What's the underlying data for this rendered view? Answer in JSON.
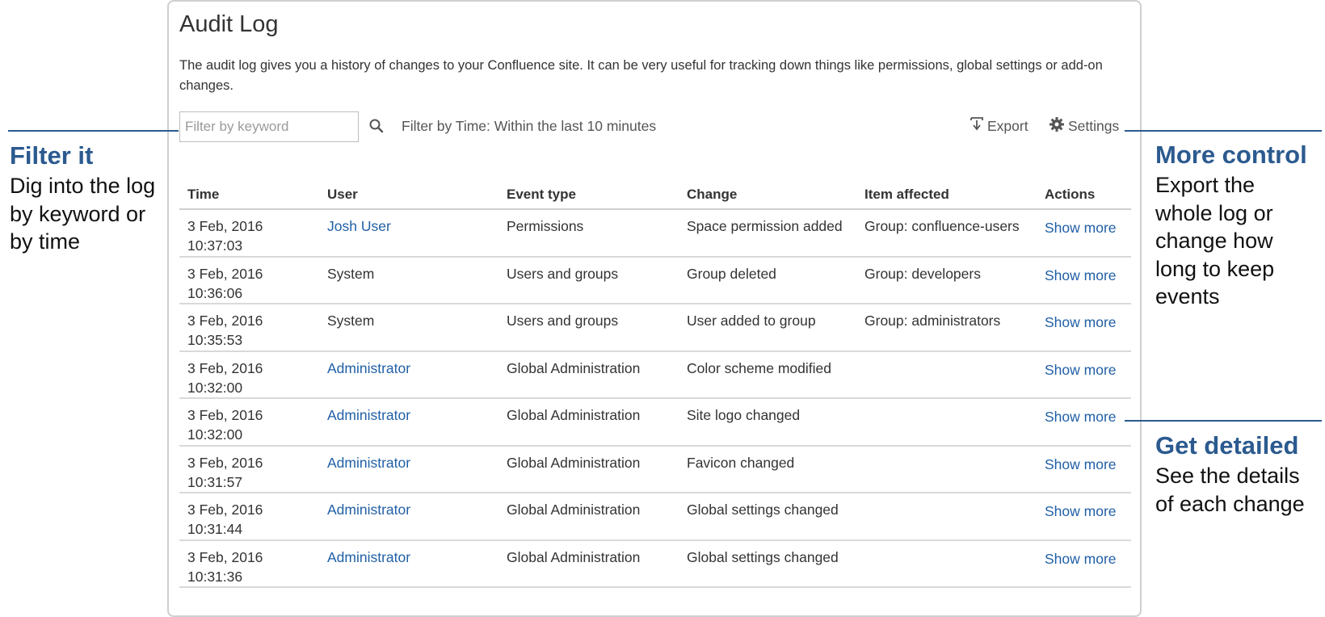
{
  "header": {
    "title": "Audit Log",
    "description": "The audit log gives you a history of changes to your Confluence site. It can be very useful for tracking down things like permissions, global settings or add-on changes."
  },
  "toolbar": {
    "filter_placeholder": "Filter by keyword",
    "filter_value": "",
    "time_filter": "Filter by Time: Within the last 10 minutes",
    "export_label": "Export",
    "settings_label": "Settings",
    "icons": [
      "search-icon",
      "export-icon",
      "gear-icon"
    ]
  },
  "table": {
    "columns": [
      "Time",
      "User",
      "Event type",
      "Change",
      "Item affected",
      "Actions"
    ],
    "rows": [
      {
        "date": "3 Feb, 2016",
        "time": "10:37:03",
        "user": "Josh User",
        "user_link": true,
        "event": "Permissions",
        "change": "Space permission added",
        "item": "Group: confluence-users",
        "action": "Show more"
      },
      {
        "date": "3 Feb, 2016",
        "time": "10:36:06",
        "user": "System",
        "user_link": false,
        "event": "Users and groups",
        "change": "Group deleted",
        "item": "Group: developers",
        "action": "Show more"
      },
      {
        "date": "3 Feb, 2016",
        "time": "10:35:53",
        "user": "System",
        "user_link": false,
        "event": "Users and groups",
        "change": "User added to group",
        "item": "Group: administrators",
        "action": "Show more"
      },
      {
        "date": "3 Feb, 2016",
        "time": "10:32:00",
        "user": "Administrator",
        "user_link": true,
        "event": "Global Administration",
        "change": "Color scheme modified",
        "item": "",
        "action": "Show more"
      },
      {
        "date": "3 Feb, 2016",
        "time": "10:32:00",
        "user": "Administrator",
        "user_link": true,
        "event": "Global Administration",
        "change": "Site logo changed",
        "item": "",
        "action": "Show more"
      },
      {
        "date": "3 Feb, 2016",
        "time": "10:31:57",
        "user": "Administrator",
        "user_link": true,
        "event": "Global Administration",
        "change": "Favicon changed",
        "item": "",
        "action": "Show more"
      },
      {
        "date": "3 Feb, 2016",
        "time": "10:31:44",
        "user": "Administrator",
        "user_link": true,
        "event": "Global Administration",
        "change": "Global settings changed",
        "item": "",
        "action": "Show more"
      },
      {
        "date": "3 Feb, 2016",
        "time": "10:31:36",
        "user": "Administrator",
        "user_link": true,
        "event": "Global Administration",
        "change": "Global settings changed",
        "item": "",
        "action": "Show more"
      }
    ]
  },
  "callouts": {
    "filter": {
      "title": "Filter it",
      "text": "Dig into the log by keyword or by time"
    },
    "control": {
      "title": "More control",
      "text": "Export the whole log or change how long to keep events"
    },
    "detail": {
      "title": "Get detailed",
      "text": "See the details of each change"
    }
  },
  "colors": {
    "accent": "#2b5a8f",
    "link": "#205fa6"
  }
}
